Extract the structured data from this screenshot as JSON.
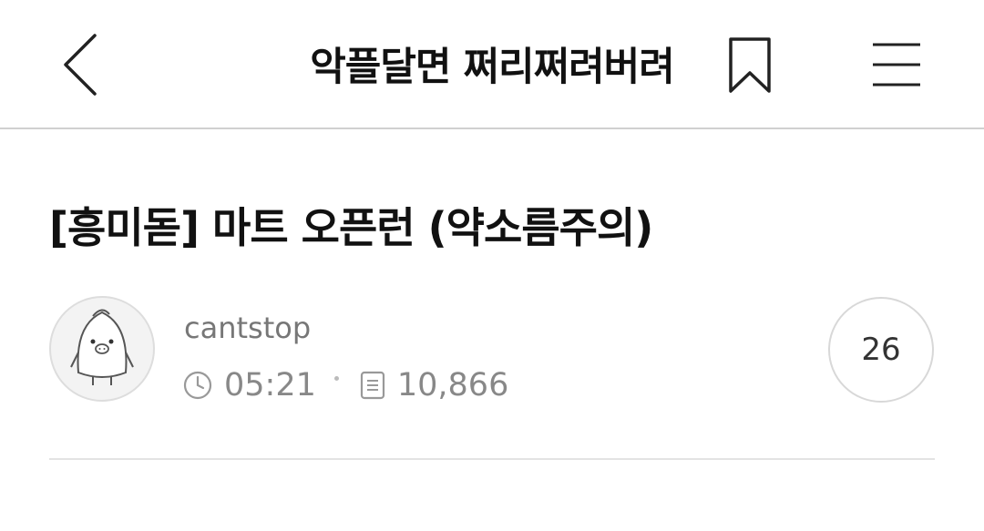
{
  "header": {
    "board_title": "악플달면 쩌리쩌려버려",
    "back_icon": "chevron-left-icon",
    "bookmark_icon": "bookmark-icon",
    "menu_icon": "hamburger-menu-icon"
  },
  "post": {
    "title": "[흥미돋] 마트 오픈런 (약소름주의)",
    "author": "cantstop",
    "avatar_icon": "penguin-avatar-icon",
    "time": "05:21",
    "time_icon": "clock-icon",
    "views": "10,866",
    "views_icon": "document-icon",
    "comment_count": "26"
  }
}
